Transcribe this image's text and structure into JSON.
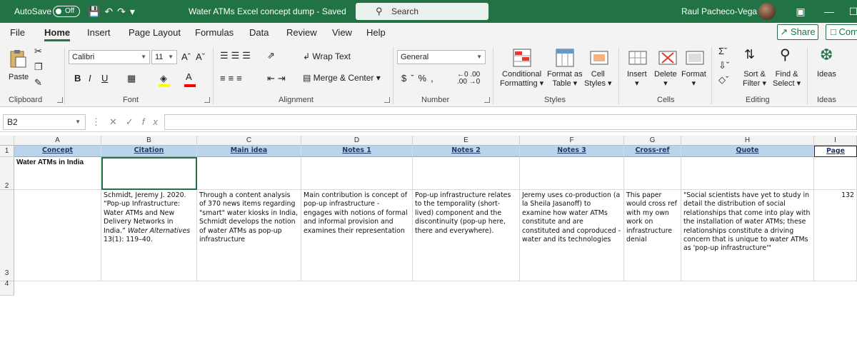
{
  "titlebar": {
    "autosave_label": "AutoSave",
    "autosave_state": "Off",
    "doc_title": "Water ATMs Excel concept dump  -  Saved",
    "search_placeholder": "Search",
    "user_name": "Raul Pacheco-Vega"
  },
  "tabs": [
    "File",
    "Home",
    "Insert",
    "Page Layout",
    "Formulas",
    "Data",
    "Review",
    "View",
    "Help"
  ],
  "tabs_active": "Home",
  "share_label": "Share",
  "comments_label": "Com",
  "ribbon": {
    "paste": "Paste",
    "clipboard": "Clipboard",
    "font_name": "Calibri",
    "font_size": "11",
    "font_group": "Font",
    "wrap_text": "Wrap Text",
    "merge_center": "Merge & Center",
    "alignment": "Alignment",
    "number_format": "General",
    "number": "Number",
    "conditional": "Conditional",
    "formatting": "Formatting",
    "format_as": "Format as",
    "table": "Table",
    "cell": "Cell",
    "styles_btn": "Styles",
    "styles": "Styles",
    "insert": "Insert",
    "delete": "Delete",
    "format": "Format",
    "cells": "Cells",
    "sort": "Sort &",
    "filter": "Filter",
    "find": "Find &",
    "select": "Select",
    "editing": "Editing",
    "ideas": "Ideas",
    "ideas_group": "Ideas"
  },
  "namebox": "B2",
  "fx": "fx",
  "columns": [
    "A",
    "B",
    "C",
    "D",
    "E",
    "F",
    "G",
    "H",
    "I"
  ],
  "rows": [
    "1",
    "2",
    "3",
    "4"
  ],
  "header_row": [
    "Concept",
    "Citation",
    "Main idea",
    "Notes 1",
    "Notes 2",
    "Notes 3",
    "Cross-ref",
    "Quote",
    "Page"
  ],
  "row2_A": "Water ATMs in India",
  "row3": {
    "citation": "Schmidt, Jeremy J. 2020. “Pop-up Infrastructure: Water ATMs and New Delivery Networks in India.”",
    "citation_journal": "Water Alternatives",
    "citation_end": "13(1): 119–40.",
    "main_idea": "Through a content analysis of 370 news items regarding \"smart\" water kiosks in India, Schmidt develops the notion of water ATMs as pop-up infrastructure",
    "notes1": "Main contribution is concept of pop-up infrastructure - engages with notions of formal and informal provision and examines their representation",
    "notes2": "Pop-up infrastructure relates to the temporality (short-lived) component and the discontinuity (pop-up here, there and everywhere).",
    "notes3": "Jeremy uses co-production (a la Sheila Jasanoff) to examine how water ATMs constitute and are constituted and coproduced - water and its technologies",
    "crossref": "This paper would cross ref with my own work on infrastructure denial",
    "quote": "\"Social scientists have yet to study in detail the distribution of social relationships that come into play with the installation of water ATMs; these relationships constitute a driving concern that is unique to water ATMs as 'pop-up infrastructure'\"",
    "page": "132"
  }
}
